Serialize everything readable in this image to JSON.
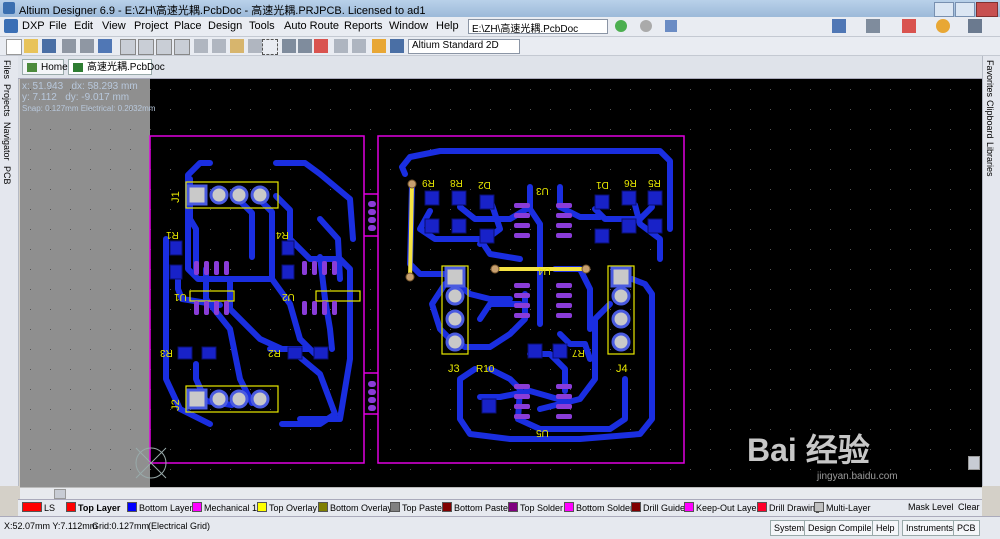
{
  "title_bar": {
    "title": "Altium Designer 6.9 - E:\\ZH\\高速光耦.PcbDoc - 高速光耦.PRJPCB. Licensed to ad1"
  },
  "menu": {
    "items": [
      "DXP",
      "File",
      "Edit",
      "View",
      "Project",
      "Place",
      "Design",
      "Tools",
      "Auto Route",
      "Reports",
      "Window",
      "Help"
    ],
    "path_combo": "E:\\ZH\\高速光耦.PcbDoc"
  },
  "toolbar": {
    "view_mode": "Altium Standard 2D"
  },
  "left_panels": [
    "Files",
    "Projects",
    "Navigator",
    "PCB"
  ],
  "right_panels": [
    "Favorites",
    "Clipboard",
    "Libraries"
  ],
  "doc_tabs": [
    "Home",
    "高速光耦.PcbDoc"
  ],
  "hud": {
    "x": "x: 51.943",
    "dx": "dx: 58.293 mm",
    "y": "y:  7.112",
    "dy": "dy: -9.017 mm",
    "snap": "Snap: 0.127mm Electrical: 0.2032mm"
  },
  "designators": {
    "J1": "J1",
    "J2": "J2",
    "J3": "J3",
    "J4": "J4",
    "R1": "R1",
    "R2": "R2",
    "R3": "R3",
    "R4": "R4",
    "R5": "R5",
    "R6": "R6",
    "R7": "R7",
    "R8": "R8",
    "R9": "R9",
    "R10": "R10",
    "U1": "U1",
    "U2": "U2",
    "U3": "U3",
    "U4": "U4",
    "U5": "U5",
    "D1": "D1",
    "D2": "D2"
  },
  "layer_tabs": [
    {
      "label": "LS",
      "color": "#ff0000"
    },
    {
      "label": "Top Layer",
      "color": "#ff0000"
    },
    {
      "label": "Bottom Layer",
      "color": "#0000ff"
    },
    {
      "label": "Mechanical 1",
      "color": "#ff00ff"
    },
    {
      "label": "Top Overlay",
      "color": "#ffff00"
    },
    {
      "label": "Bottom Overlay",
      "color": "#808000"
    },
    {
      "label": "Top Paste",
      "color": "#808080"
    },
    {
      "label": "Bottom Paste",
      "color": "#800000"
    },
    {
      "label": "Top Solder",
      "color": "#800080"
    },
    {
      "label": "Bottom Solder",
      "color": "#ff00ff"
    },
    {
      "label": "Drill Guide",
      "color": "#800000"
    },
    {
      "label": "Keep-Out Layer",
      "color": "#ff00ff"
    },
    {
      "label": "Drill Drawing",
      "color": "#ff002a"
    },
    {
      "label": "Multi-Layer",
      "color": "#c0c0c0"
    },
    {
      "label": "Mask Level",
      "color": ""
    },
    {
      "label": "Clear",
      "color": ""
    }
  ],
  "status": {
    "coords": "X:52.07mm Y:7.112mm",
    "grid": "Grid:0.127mm",
    "grid_type": "(Electrical Grid)",
    "buttons": [
      "System",
      "Design Compiler",
      "Help",
      "Instruments",
      "PCB"
    ]
  },
  "watermark": {
    "text": "Bai 经验",
    "sub": "jingyan.baidu.com"
  },
  "colors": {
    "trace": "#1a2ee0",
    "board_outline": "#e000e0",
    "silk": "#e8e800",
    "pad": "#c9c9c9",
    "canvas": "#000000"
  }
}
